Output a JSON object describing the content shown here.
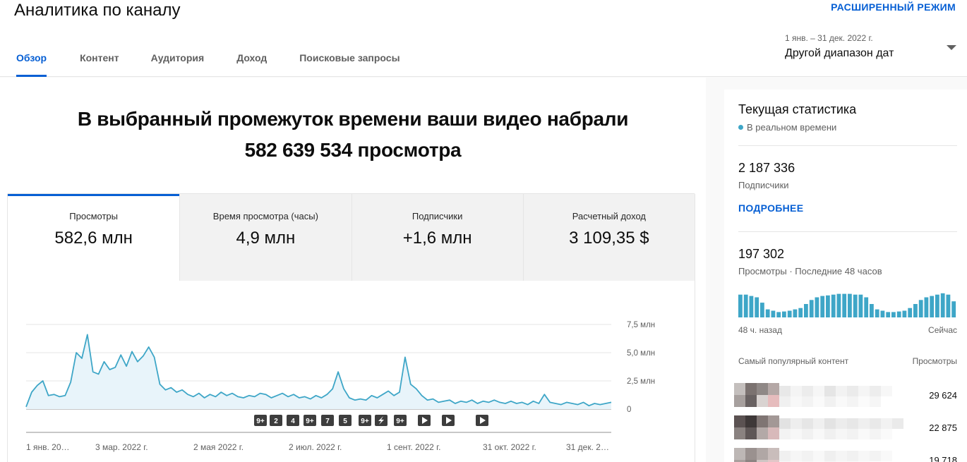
{
  "header": {
    "title": "Аналитика по каналу",
    "advanced_mode": "РАСШИРЕННЫЙ РЕЖИМ",
    "tabs": [
      {
        "label": "Обзор",
        "active": true
      },
      {
        "label": "Контент",
        "active": false
      },
      {
        "label": "Аудитория",
        "active": false
      },
      {
        "label": "Доход",
        "active": false
      },
      {
        "label": "Поисковые запросы",
        "active": false
      }
    ],
    "date_range": {
      "sub": "1 янв. – 31 дек. 2022 г.",
      "main": "Другой диапазон дат"
    }
  },
  "main": {
    "headline_line1": "В выбранный промежуток времени ваши видео набрали",
    "headline_line2": "582 639 534 просмотра",
    "metrics": [
      {
        "label": "Просмотры",
        "value": "582,6 млн"
      },
      {
        "label": "Время просмотра (часы)",
        "value": "4,9 млн"
      },
      {
        "label": "Подписчики",
        "value": "+1,6 млн"
      },
      {
        "label": "Расчетный доход",
        "value": "3 109,35 $"
      }
    ]
  },
  "chart_data": {
    "type": "area",
    "series": [
      {
        "values": [
          0.2,
          1.5,
          2.1,
          2.5,
          1.2,
          1.3,
          1.1,
          1.2,
          2.4,
          5.0,
          4.5,
          6.6,
          3.3,
          3.1,
          4.2,
          3.5,
          3.7,
          4.8,
          3.8,
          5.1,
          4.2,
          4.7,
          5.5,
          4.6,
          2.2,
          1.7,
          1.9,
          1.5,
          1.7,
          1.3,
          1.1,
          1.4,
          1.0,
          1.3,
          1.1,
          1.5,
          1.2,
          1.4,
          1.1,
          1.0,
          1.2,
          1.1,
          1.4,
          1.3,
          1.0,
          1.2,
          1.4,
          1.1,
          1.3,
          1.0,
          1.1,
          0.9,
          1.2,
          1.0,
          1.3,
          1.8,
          3.3,
          1.8,
          1.0,
          0.8,
          0.9,
          0.8,
          1.2,
          1.0,
          1.3,
          1.6,
          1.2,
          1.5,
          4.6,
          2.2,
          1.8,
          1.2,
          0.8,
          0.9,
          0.6,
          0.7,
          0.8,
          0.5,
          0.7,
          0.6,
          0.8,
          0.5,
          0.7,
          0.6,
          0.8,
          0.6,
          0.5,
          0.7,
          0.5,
          0.6,
          0.4,
          0.7,
          0.5,
          1.3,
          0.6,
          0.5,
          0.4,
          0.6,
          0.5,
          0.4,
          0.6,
          0.3,
          0.5,
          0.4,
          0.5,
          0.6
        ]
      }
    ],
    "x_labels": [
      "1 янв. 20…",
      "3 мар. 2022 г.",
      "2 мая 2022 г.",
      "2 июл. 2022 г.",
      "1 сент. 2022 г.",
      "31 окт. 2022 г.",
      "31 дек. 2…"
    ],
    "y_ticks": [
      {
        "value": 0,
        "label": "0"
      },
      {
        "value": 2.5,
        "label": "2,5 млн"
      },
      {
        "value": 5,
        "label": "5,0 млн"
      },
      {
        "value": 7.5,
        "label": "7,5 млн"
      }
    ],
    "ylim": [
      0,
      7.5
    ],
    "color": "#3ea6c7",
    "fill": "#e8f4fa",
    "markers": [
      "9+",
      "2",
      "4",
      "9+",
      "7",
      "5",
      "9+",
      "short",
      "9+",
      "play",
      "play",
      "play"
    ]
  },
  "side": {
    "title": "Текущая статистика",
    "realtime": "В реальном времени",
    "subscribers_value": "2 187 336",
    "subscribers_label": "Подписчики",
    "more": "ПОДРОБНЕЕ",
    "views_value": "197 302",
    "views_label": "Просмотры · Последние 48 часов",
    "mini_bars": [
      0.85,
      0.85,
      0.8,
      0.75,
      0.55,
      0.3,
      0.25,
      0.2,
      0.22,
      0.25,
      0.3,
      0.35,
      0.5,
      0.65,
      0.75,
      0.8,
      0.82,
      0.85,
      0.88,
      0.88,
      0.88,
      0.85,
      0.85,
      0.75,
      0.5,
      0.3,
      0.25,
      0.2,
      0.2,
      0.22,
      0.25,
      0.35,
      0.5,
      0.65,
      0.75,
      0.8,
      0.85,
      0.9,
      0.85,
      0.6
    ],
    "mini_left": "48 ч. назад",
    "mini_right": "Сейчас",
    "top_head_left": "Самый популярный контент",
    "top_head_right": "Просмотры",
    "top_items": [
      {
        "views": "29 624"
      },
      {
        "views": "22 875"
      },
      {
        "views": "19 718"
      }
    ]
  }
}
